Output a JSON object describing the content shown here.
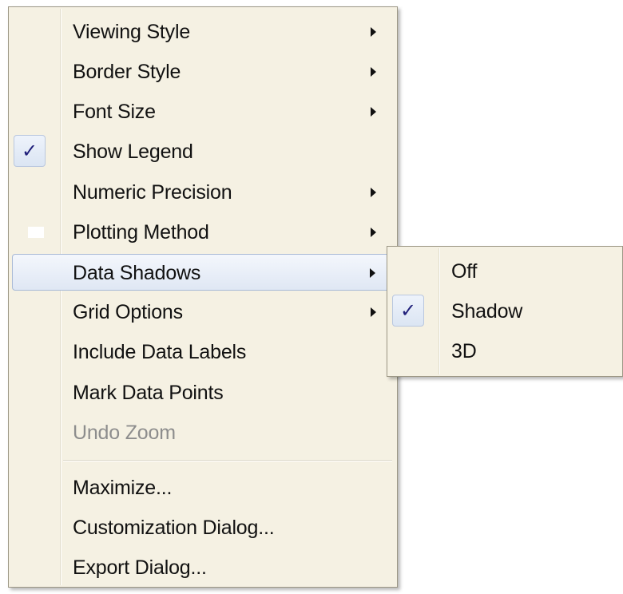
{
  "main_menu": {
    "items": [
      {
        "label": "Viewing Style",
        "submenu": true
      },
      {
        "label": "Border Style",
        "submenu": true
      },
      {
        "label": "Font Size",
        "submenu": true
      },
      {
        "label": "Show Legend",
        "checked": true
      },
      {
        "label": "Numeric Precision",
        "submenu": true
      },
      {
        "label": "Plotting Method",
        "submenu": true
      },
      {
        "label": "Data Shadows",
        "submenu": true,
        "highlighted": true
      },
      {
        "label": "Grid Options",
        "submenu": true
      },
      {
        "label": "Include Data Labels"
      },
      {
        "label": "Mark Data Points"
      },
      {
        "label": "Undo Zoom",
        "disabled": true
      },
      {
        "label": "Maximize..."
      },
      {
        "label": "Customization Dialog..."
      },
      {
        "label": "Export Dialog..."
      }
    ]
  },
  "submenu": {
    "parent": "Data Shadows",
    "items": [
      {
        "label": "Off"
      },
      {
        "label": "Shadow",
        "checked": true
      },
      {
        "label": "3D"
      }
    ]
  },
  "check_glyph": "✓",
  "colors": {
    "menu_background": "#f5f1e3",
    "highlight_border": "#a9bad6",
    "check_color": "#1f1f7a",
    "disabled_text": "#8d8d8d"
  }
}
